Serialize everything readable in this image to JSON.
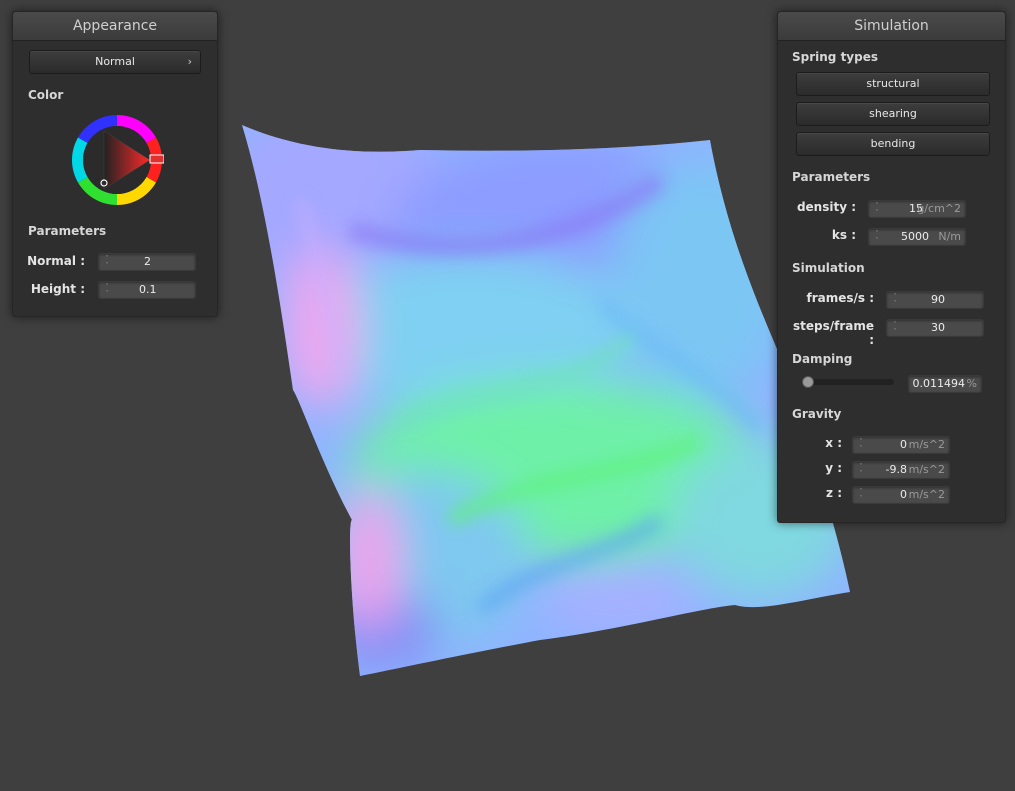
{
  "appearance": {
    "title": "Appearance",
    "shader_value": "Normal",
    "shader_arrow": "›",
    "color_label": "Color",
    "parameters_label": "Parameters",
    "normal": {
      "label": "Normal :",
      "value": "2"
    },
    "height": {
      "label": "Height :",
      "value": "0.1"
    }
  },
  "simulation": {
    "title": "Simulation",
    "spring_types_label": "Spring types",
    "spring_buttons": [
      "structural",
      "shearing",
      "bending"
    ],
    "parameters_label": "Parameters",
    "density": {
      "label": "density :",
      "value": "15",
      "unit": "g/cm^2"
    },
    "ks": {
      "label": "ks :",
      "value": "5000",
      "unit": "N/m"
    },
    "simulation_label": "Simulation",
    "frames": {
      "label": "frames/s :",
      "value": "90"
    },
    "steps": {
      "label": "steps/frame :",
      "value": "30"
    },
    "damping_label": "Damping",
    "damping": {
      "value": "0.011494",
      "unit": "%",
      "slider_fraction": 0.0
    },
    "gravity_label": "Gravity",
    "gravity": [
      {
        "label": "x :",
        "value": "0",
        "unit": "m/s^2"
      },
      {
        "label": "y :",
        "value": "-9.8",
        "unit": "m/s^2"
      },
      {
        "label": "z :",
        "value": "0",
        "unit": "m/s^2"
      }
    ]
  },
  "colors": {
    "background": "#3f3f3f",
    "panel": "#2e2e2e",
    "picker_selected": "#e03030"
  },
  "icons": [
    "spin-arrows-icon",
    "chevron-right-icon",
    "color-wheel-icon"
  ]
}
